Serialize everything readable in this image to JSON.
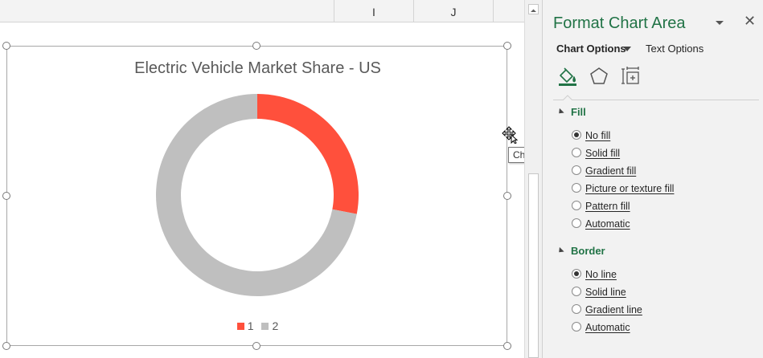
{
  "sheet": {
    "columns": [
      "I",
      "J"
    ]
  },
  "chart": {
    "title": "Electric Vehicle Market Share - US",
    "tooltip": "Chart Area"
  },
  "chart_data": {
    "type": "pie",
    "subtype": "doughnut",
    "title": "Electric Vehicle Market Share - US",
    "categories": [
      "1",
      "2"
    ],
    "values": [
      28,
      72
    ],
    "colors": [
      "#ff503c",
      "#bfbfbf"
    ],
    "legend_position": "bottom"
  },
  "pane": {
    "title": "Format Chart Area",
    "tabs": {
      "chart_options": "Chart Options",
      "text_options": "Text Options"
    },
    "icons": [
      "fill-line-icon",
      "effects-icon",
      "size-properties-icon"
    ],
    "fill": {
      "header": "Fill",
      "options": [
        "No fill",
        "Solid fill",
        "Gradient fill",
        "Picture or texture fill",
        "Pattern fill",
        "Automatic"
      ],
      "selected": "No fill"
    },
    "border": {
      "header": "Border",
      "options": [
        "No line",
        "Solid line",
        "Gradient line",
        "Automatic"
      ],
      "selected": "No line"
    }
  },
  "colors": {
    "accent_green": "#217346",
    "slice_1": "#ff503c",
    "slice_2": "#bfbfbf"
  }
}
